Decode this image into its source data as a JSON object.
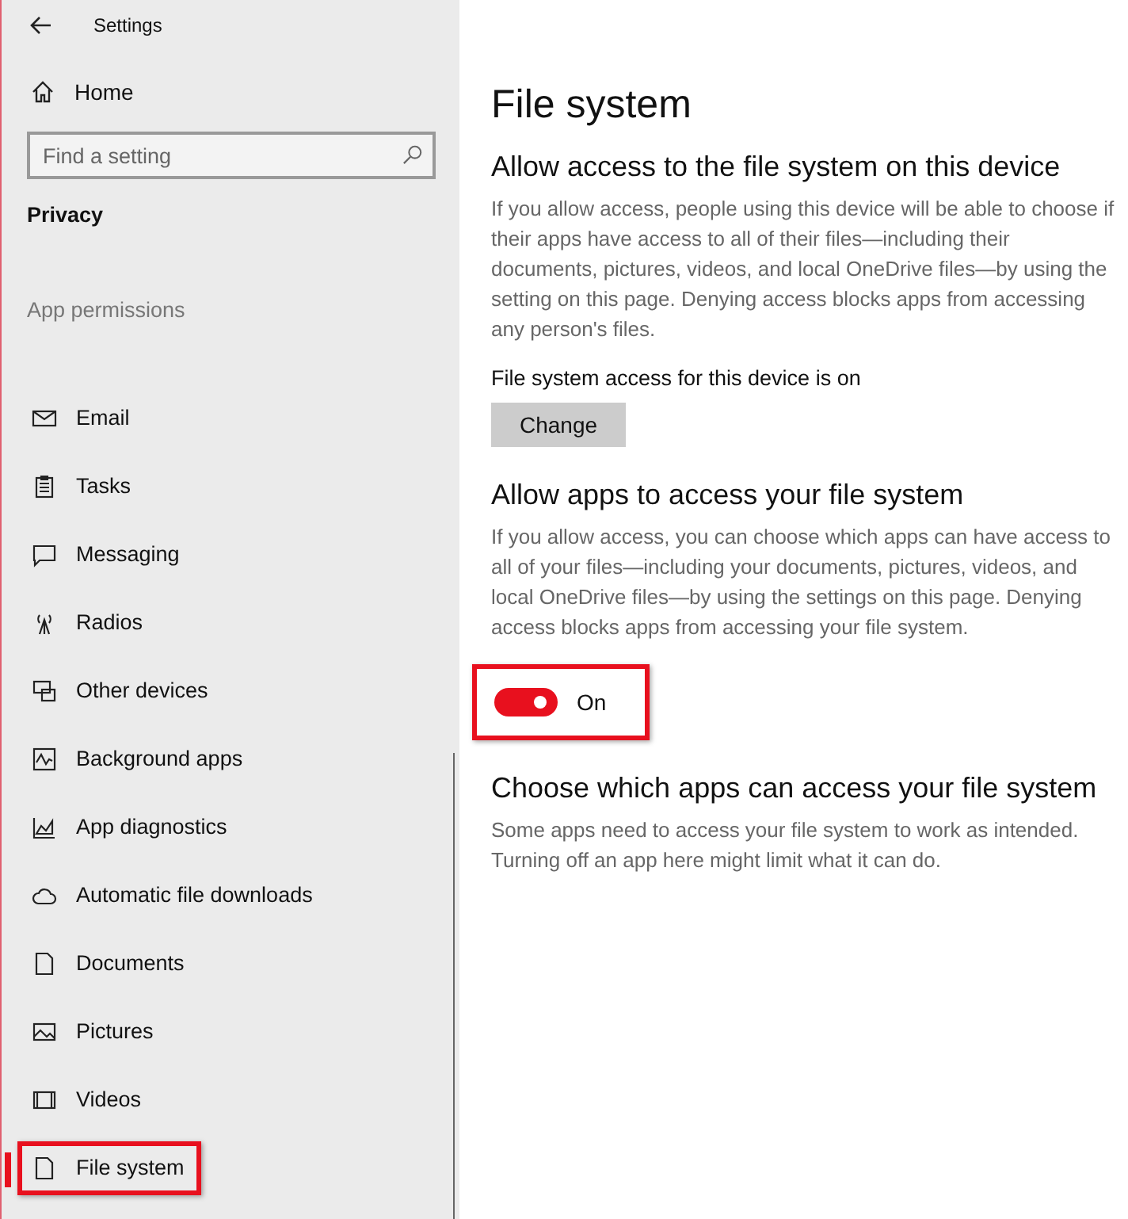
{
  "window": {
    "title": "Settings"
  },
  "sidebar": {
    "home": "Home",
    "search": {
      "placeholder": "Find a setting"
    },
    "category": "Privacy",
    "group": "App permissions",
    "items": [
      {
        "label": "Email",
        "selected": false,
        "highlighted": false
      },
      {
        "label": "Tasks",
        "selected": false,
        "highlighted": false
      },
      {
        "label": "Messaging",
        "selected": false,
        "highlighted": false
      },
      {
        "label": "Radios",
        "selected": false,
        "highlighted": false
      },
      {
        "label": "Other devices",
        "selected": false,
        "highlighted": false
      },
      {
        "label": "Background apps",
        "selected": false,
        "highlighted": false
      },
      {
        "label": "App diagnostics",
        "selected": false,
        "highlighted": false
      },
      {
        "label": "Automatic file downloads",
        "selected": false,
        "highlighted": false
      },
      {
        "label": "Documents",
        "selected": false,
        "highlighted": false
      },
      {
        "label": "Pictures",
        "selected": false,
        "highlighted": false
      },
      {
        "label": "Videos",
        "selected": false,
        "highlighted": false
      },
      {
        "label": "File system",
        "selected": true,
        "highlighted": true
      }
    ]
  },
  "page": {
    "title": "File system",
    "sections": [
      {
        "kind": "button",
        "heading": "Allow access to the file system on this device",
        "text": "If you allow access, people using this device will be able to choose if their apps have access to all of their files—including their documents, pictures, videos, and local OneDrive files—by using the setting on this page. Denying access blocks apps from accessing any person's files.",
        "status": "File system access for this device is on",
        "button": "Change"
      },
      {
        "kind": "toggle",
        "heading": "Allow apps to access your file system",
        "text": "If you allow access, you can choose which apps can have access to all of your files—including your documents, pictures, videos, and local OneDrive files—by using the settings on this page. Denying access blocks apps from accessing your file system.",
        "toggle": {
          "on": true,
          "label": "On",
          "highlighted": true
        }
      },
      {
        "kind": "text",
        "heading": "Choose which apps can access your file system",
        "text": "Some apps need to access your file system to work as intended. Turning off an app here might limit what it can do."
      }
    ]
  }
}
